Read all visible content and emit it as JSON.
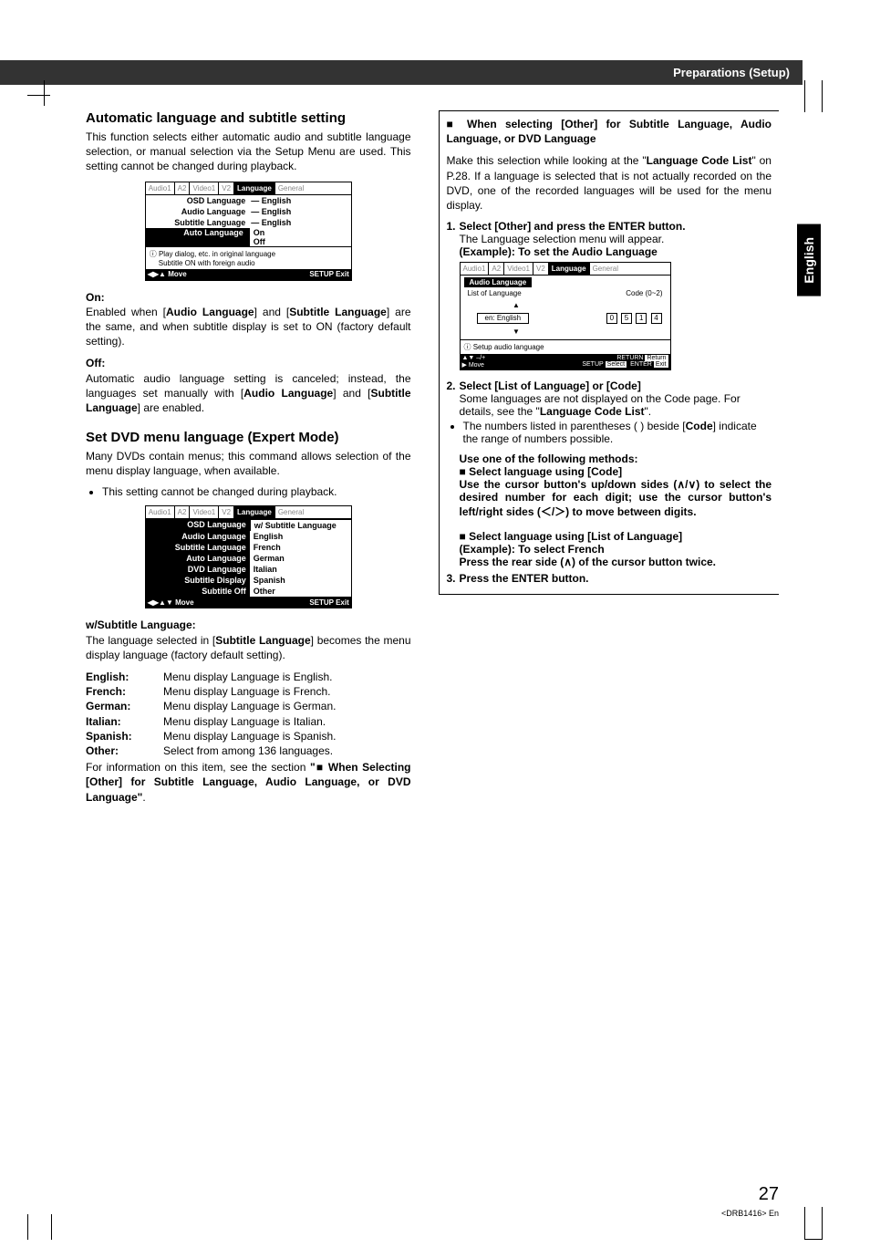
{
  "header": {
    "section": "Preparations (Setup)"
  },
  "side_tab": "English",
  "page_number": "27",
  "page_footer": "<DRB1416> En",
  "left": {
    "h1": "Automatic language and subtitle setting",
    "p1": "This function selects either automatic audio and subtitle language selection, or manual selection via the Setup Menu are used. This setting cannot be changed during playback.",
    "menu1": {
      "tabs": [
        "Audio1",
        "A2",
        "Video1",
        "V2",
        "Language",
        "General"
      ],
      "active_tab": "Language",
      "rows": [
        {
          "l": "OSD Language",
          "d": "—",
          "r": "English"
        },
        {
          "l": "Audio Language",
          "d": "—",
          "r": "English"
        },
        {
          "l": "Subtitle Language",
          "d": "—",
          "r": "English"
        }
      ],
      "sel": {
        "l": "Auto Language",
        "opts": [
          "On",
          "Off"
        ]
      },
      "info1": "ⓘ Play dialog, etc. in original language",
      "info2": "Subtitle ON with foreign audio",
      "foot_l": "◀▶▲   Move",
      "foot_r": "SETUP  Exit"
    },
    "on_h": "On:",
    "on_p_a": "Enabled when [",
    "on_p_b": "Audio Language",
    "on_p_c": "] and [",
    "on_p_d": "Subtitle Language",
    "on_p_e": "] are the same, and when subtitle display is set to ON (factory default setting).",
    "off_h": "Off:",
    "off_p_a": "Automatic audio language setting is canceled; instead, the languages set manually with [",
    "off_p_b": "Audio Language",
    "off_p_c": "] and [",
    "off_p_d": "Subtitle Language",
    "off_p_e": "] are enabled.",
    "h2": "Set DVD menu language (Expert Mode)",
    "p2": "Many DVDs contain menus; this command allows selection of the menu display language, when available.",
    "p2b": "This setting cannot be changed during playback.",
    "menu2": {
      "tabs": [
        "Audio1",
        "A2",
        "Video1",
        "V2",
        "Language",
        "General"
      ],
      "active_tab": "Language",
      "rows": [
        {
          "l": "OSD Language",
          "r": "w/ Subtitle Language"
        },
        {
          "l": "Audio Language",
          "r": "English"
        },
        {
          "l": "Subtitle Language",
          "r": "French"
        },
        {
          "l": "Auto Language",
          "r": "German"
        },
        {
          "l": "DVD Language",
          "r": "Italian"
        },
        {
          "l": "Subtitle Display",
          "r": "Spanish"
        },
        {
          "l": "Subtitle Off",
          "r": "Other"
        }
      ],
      "foot_l": "◀▶▲▼ Move",
      "foot_r": "SETUP  Exit"
    },
    "wsl_h": "w/Subtitle Language:",
    "wsl_p_a": "The language selected in [",
    "wsl_p_b": "Subtitle Language",
    "wsl_p_c": "] becomes the menu display language (factory default setting).",
    "langs": [
      {
        "l": "English:",
        "r": "Menu display Language is English."
      },
      {
        "l": "French:",
        "r": "Menu display Language is French."
      },
      {
        "l": "German:",
        "r": "Menu display Language is German."
      },
      {
        "l": "Italian:",
        "r": "Menu display Language is Italian."
      },
      {
        "l": "Spanish:",
        "r": "Menu display Language is Spanish."
      },
      {
        "l": "Other:",
        "r": "Select from among 136 languages."
      }
    ],
    "tail_a": "For information on this item, see the section ",
    "tail_b": "\"■ When Selecting [Other] for Subtitle Language, Audio Language, or DVD Language\"",
    "tail_c": "."
  },
  "right": {
    "h1a": "When selecting [Other] for Subtitle Language, Audio Language, or DVD Language",
    "p1_a": "Make this selection while looking at the \"",
    "p1_b": "Language Code List",
    "p1_c": "\" on P.28. If a language is selected that is not actually recorded on the DVD, one of the recorded languages will be used for the menu display.",
    "step1": "Select [Other] and press the ENTER button.",
    "step1_sub": "The Language selection menu will appear.",
    "step1_ex": "(Example): To set the Audio Language",
    "box3": {
      "tabs": [
        "Audio1",
        "A2",
        "Video1",
        "V2",
        "Language",
        "General"
      ],
      "active_tab": "Language",
      "title": "Audio Language",
      "list_label": "List of Language",
      "code_label": "Code (0~2)",
      "entry": "en: English",
      "digits": [
        "0",
        "5",
        "1",
        "4"
      ],
      "info": "ⓘ Setup audio language",
      "foot_left1": "▲▼ –/+",
      "foot_left2": "▶ Move",
      "foot_right": [
        {
          "k": "RETURN",
          "v": "Return"
        },
        {
          "k": "SETUP",
          "v": "Select"
        },
        {
          "k": "ENTER",
          "v": "Exit"
        }
      ]
    },
    "step2": "Select [List of Language] or [Code]",
    "step2_sub_a": "Some languages are not displayed on the Code page. For details, see the \"",
    "step2_sub_b": "Language Code List",
    "step2_sub_c": "\".",
    "step2_bul_a": "The numbers listed in parentheses ( ) beside [",
    "step2_bul_b": "Code",
    "step2_bul_c": "] indicate the range of numbers possible.",
    "use_h": "Use one of the following methods:",
    "m1_h": "Select language using [Code]",
    "m1_p": "Use the cursor button's up/down sides (∧/∨) to select the desired number for each digit; use the cursor button's left/right sides (＜/＞) to move between digits.",
    "m2_h": "Select language using [List of Language]",
    "m2_ex": "(Example): To select French",
    "m2_p": "Press the rear side (∧) of the cursor button twice.",
    "step3": "Press the ENTER button."
  }
}
